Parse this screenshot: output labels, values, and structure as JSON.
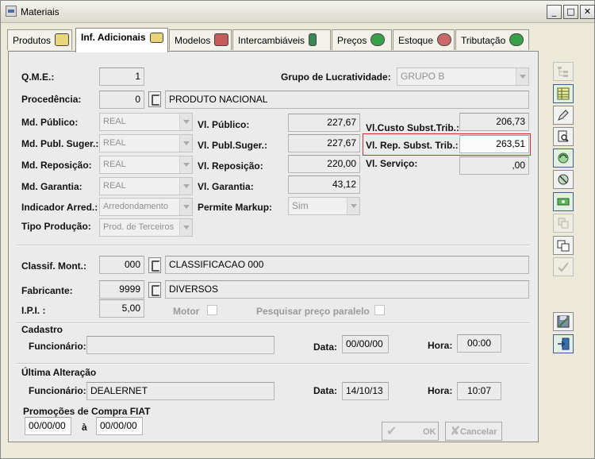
{
  "window": {
    "title": "Materiais"
  },
  "tabs": [
    {
      "label": "Produtos",
      "icon": "truck-icon"
    },
    {
      "label": "Inf. Adicionais",
      "icon": "folder-open-icon"
    },
    {
      "label": "Modelos",
      "icon": "car-icon"
    },
    {
      "label": "Intercambiáveis",
      "icon": "exchange-icon"
    },
    {
      "label": "Preços",
      "icon": "money-bag-icon"
    },
    {
      "label": "Estoque",
      "icon": "box-icon"
    },
    {
      "label": "Tributação",
      "icon": "money-bag-icon"
    }
  ],
  "form": {
    "qme": {
      "label": "Q.M.E.:",
      "value": "1"
    },
    "procedencia": {
      "label": "Procedência:",
      "code": "0",
      "desc": "PRODUTO NACIONAL"
    },
    "grupo_lucratividade": {
      "label": "Grupo de Lucratividade:",
      "value": "GRUPO B"
    },
    "md_publico": {
      "label": "Md. Público:",
      "value": "REAL"
    },
    "md_publ_suger": {
      "label": "Md. Publ. Suger.:",
      "value": "REAL"
    },
    "md_reposicao": {
      "label": "Md. Reposição:",
      "value": "REAL"
    },
    "md_garantia": {
      "label": "Md. Garantia:",
      "value": "REAL"
    },
    "indicador_arred": {
      "label": "Indicador Arred.:",
      "value": "Arredondamento"
    },
    "tipo_producao": {
      "label": "Tipo Produção:",
      "value": "Prod. de Terceiros"
    },
    "vl_publico": {
      "label": "Vl. Público:",
      "value": "227,67"
    },
    "vl_publ_suger": {
      "label": "Vl. Publ.Suger.:",
      "value": "227,67"
    },
    "vl_reposicao": {
      "label": "Vl. Reposição:",
      "value": "220,00"
    },
    "vl_garantia": {
      "label": "Vl. Garantia:",
      "value": "43,12"
    },
    "permite_markup": {
      "label": "Permite Markup:",
      "value": "Sim"
    },
    "vl_custo_subst_trib": {
      "label": "Vl.Custo Subst.Trib.:",
      "value": "206,73"
    },
    "vl_rep_subst_trib": {
      "label": "Vl. Rep. Subst. Trib.:",
      "value": "263,51"
    },
    "vl_servico": {
      "label": "Vl. Serviço:",
      "value": ",00"
    },
    "classif_mont": {
      "label": "Classif. Mont.:",
      "code": "000",
      "desc": "CLASSIFICACAO 000"
    },
    "fabricante": {
      "label": "Fabricante:",
      "code": "9999",
      "desc": "DIVERSOS"
    },
    "ipi": {
      "label": "I.P.I. :",
      "value": "5,00"
    },
    "motor": {
      "label": "Motor"
    },
    "pesquisar_preco": {
      "label": "Pesquisar preço paralelo"
    }
  },
  "cadastro": {
    "title": "Cadastro",
    "funcionario_label": "Funcionário:",
    "funcionario": "",
    "data_label": "Data:",
    "data": "00/00/00",
    "hora_label": "Hora:",
    "hora": "00:00"
  },
  "ultima_alteracao": {
    "title": "Última Alteração",
    "funcionario_label": "Funcionário:",
    "funcionario": "DEALERNET",
    "data_label": "Data:",
    "data": "14/10/13",
    "hora_label": "Hora:",
    "hora": "10:07"
  },
  "promocoes": {
    "title": "Promoções de Compra FIAT",
    "from": "00/00/00",
    "sep": "à",
    "to": "00/00/00"
  },
  "buttons": {
    "ok": "OK",
    "cancel": "Cancelar"
  },
  "colors": {
    "highlight_border": "#d03030",
    "panel_bg": "#ebebeb",
    "window_bg": "#ece9d8"
  }
}
